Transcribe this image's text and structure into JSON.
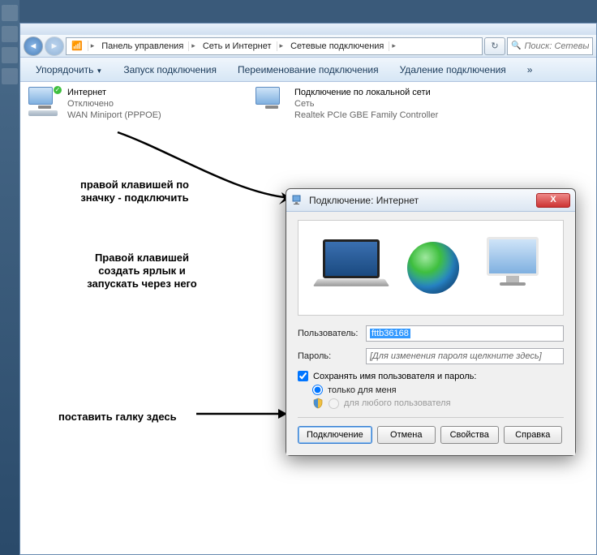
{
  "breadcrumb": {
    "seg1": "Панель управления",
    "seg2": "Сеть и Интернет",
    "seg3": "Сетевые подключения"
  },
  "search": {
    "placeholder": "Поиск: Сетевые под"
  },
  "toolbar": {
    "organize": "Упорядочить",
    "start_conn": "Запуск подключения",
    "rename": "Переименование подключения",
    "delete": "Удаление подключения",
    "more": "»"
  },
  "connections": {
    "internet": {
      "name": "Интернет",
      "status": "Отключено",
      "device": "WAN Miniport (PPPOE)"
    },
    "lan": {
      "name": "Подключение по локальной сети",
      "status": "Сеть",
      "device": "Realtek PCIe GBE Family Controller"
    }
  },
  "annotations": {
    "a1_l1": "правой клавишей по",
    "a1_l2": "значку - подключить",
    "a2_l1": "Правой клавишей",
    "a2_l2": "создать ярлык и",
    "a2_l3": "запускать через него",
    "a3": "поставить галку здесь"
  },
  "dialog": {
    "title": "Подключение: Интернет",
    "user_label": "Пользователь:",
    "user_value": "fttb36168",
    "pass_label": "Пароль:",
    "pass_placeholder": "[Для изменения пароля щелкните здесь]",
    "save_creds": "Сохранять имя пользователя и пароль:",
    "only_me": "только для меня",
    "any_user": "для любого пользователя",
    "btn_connect": "Подключение",
    "btn_cancel": "Отмена",
    "btn_props": "Свойства",
    "btn_help": "Справка"
  }
}
